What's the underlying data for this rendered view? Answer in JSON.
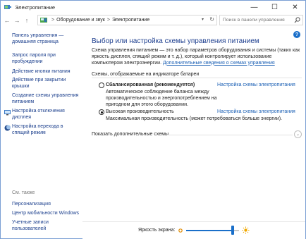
{
  "window": {
    "title": "Электропитание",
    "controls": {
      "minimize": "—",
      "maximize": "☐",
      "close": "✕"
    }
  },
  "address": {
    "back": "←",
    "forward": "→",
    "up": "↑",
    "crumbs": [
      "Оборудование и звук",
      "Электропитание"
    ],
    "separator": ">",
    "search_placeholder": "Поиск в панели управления"
  },
  "sidebar": {
    "links": [
      {
        "label": "Панель управления —\nдомашняя страница"
      },
      {
        "label": "Запрос пароля при\nпробуждении"
      },
      {
        "label": "Действие кнопки питания"
      },
      {
        "label": "Действие при закрытии\nкрышки"
      },
      {
        "label": "Создание схемы управления\nпитанием"
      },
      {
        "label": "Настройка отключения\nдисплея",
        "icon": "shield-icon"
      },
      {
        "label": "Настройка перехода в\nспящий режим",
        "icon": "moon-icon"
      }
    ],
    "see_also_title": "См. также",
    "see_also": [
      {
        "label": "Персонализация"
      },
      {
        "label": "Центр мобильности Windows"
      },
      {
        "label": "Учетные записи\nпользователей"
      }
    ]
  },
  "main": {
    "title": "Выбор или настройка схемы управления питанием",
    "intro_text": "Схема управления питанием — это набор параметров оборудования и системы (таких как яркость дисплея, спящий режим и т. д.), который контролирует использование компьютером электроэнергии. ",
    "intro_link": "Дополнительные сведения о схемах управления",
    "group_label": "Схемы, отображаемые на индикаторе батареи",
    "plans": [
      {
        "name": "Сбалансированная (рекомендуется)",
        "selected": false,
        "desc": "Автоматическое соблюдение баланса между производительностью и энергопотреблением на пригодном для этого оборудовании.",
        "link": "Настройка схемы электропитания"
      },
      {
        "name": "Высокая производительность",
        "selected": true,
        "desc": "Максимальная производительность (может потребоваться больше энергии).",
        "link": "Настройка схемы электропитания"
      }
    ],
    "more_label": "Показать дополнительные схемы",
    "help": "?"
  },
  "bottom": {
    "brightness_label": "Яркость экрана:",
    "brightness_level": 0.88
  },
  "colors": {
    "accent": "#1a6fc9",
    "link": "#1a5fb4",
    "title": "#1e3f8f"
  }
}
